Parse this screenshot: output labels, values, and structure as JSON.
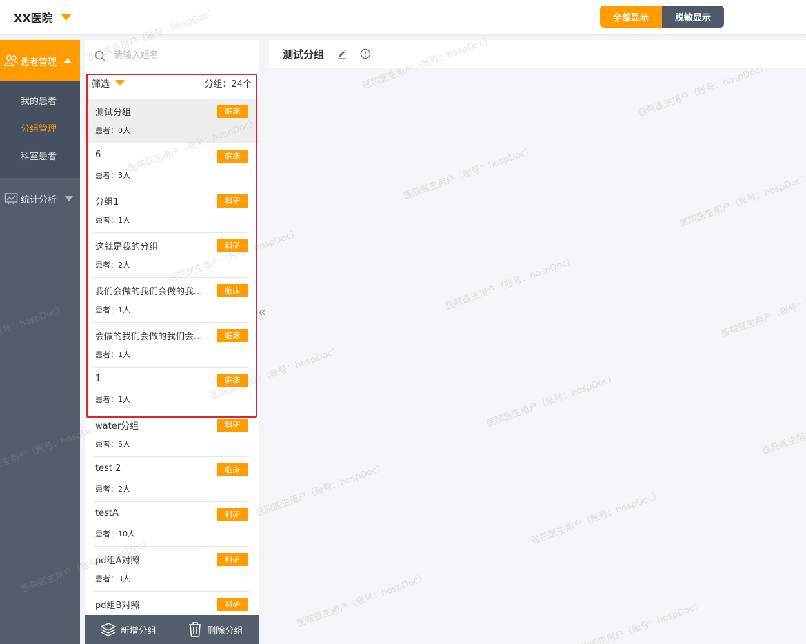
{
  "header": {
    "hospital_name": "XX医院",
    "toggle_all": "全部显示",
    "toggle_mask": "脱敏显示"
  },
  "nav": {
    "patient_mgmt": "患者管理",
    "items": [
      {
        "label": "我的患者"
      },
      {
        "label": "分组管理"
      },
      {
        "label": "科室患者"
      }
    ],
    "stats": "统计分析"
  },
  "panel": {
    "search_placeholder": "请输入组名",
    "filter_label": "筛选",
    "group_count": "分组：24个",
    "groups": [
      {
        "name": "测试分组",
        "tag": "临床",
        "count": "患者：0人"
      },
      {
        "name": "6",
        "tag": "临床",
        "count": "患者：3人"
      },
      {
        "name": "分组1",
        "tag": "科研",
        "count": "患者：1人"
      },
      {
        "name": "这就是我的分组",
        "tag": "科研",
        "count": "患者：2人"
      },
      {
        "name": "我们会做的我们会做的我...",
        "tag": "临床",
        "count": "患者：1人"
      },
      {
        "name": "会做的我们会做的我们会...",
        "tag": "临床",
        "count": "患者：1人"
      },
      {
        "name": "1",
        "tag": "临床",
        "count": "患者：1人"
      },
      {
        "name": "water分组",
        "tag": "科研",
        "count": "患者：5人"
      },
      {
        "name": "test 2",
        "tag": "临床",
        "count": "患者：2人"
      },
      {
        "name": "testA",
        "tag": "科研",
        "count": "患者：10人"
      },
      {
        "name": "pd组A对照",
        "tag": "科研",
        "count": "患者：3人"
      },
      {
        "name": "pd组B对照",
        "tag": "科研",
        "count": ""
      }
    ],
    "add_group": "新增分组",
    "delete_group": "删除分组"
  },
  "main": {
    "title": "测试分组"
  },
  "watermark_text": "医院医生用户（账号：hospDoc）",
  "colors": {
    "accent": "#ff9c00",
    "nav_bg": "#535d6c",
    "highlight": "#e5212a"
  }
}
